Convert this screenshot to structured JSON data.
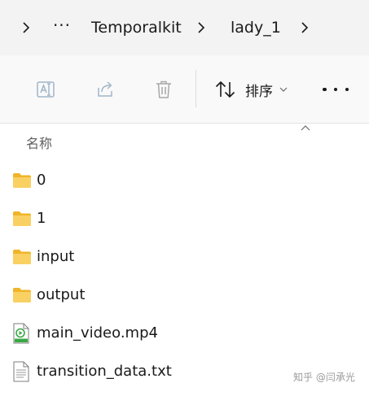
{
  "breadcrumb": {
    "more_label": "···",
    "items": [
      {
        "label": "Temporalkit"
      },
      {
        "label": "lady_1"
      }
    ]
  },
  "toolbar": {
    "buttons": [
      {
        "name": "rename",
        "icon": "rename-icon"
      },
      {
        "name": "share",
        "icon": "share-icon"
      },
      {
        "name": "delete",
        "icon": "trash-icon"
      }
    ],
    "sort_label": "排序",
    "more_icon": "more-icon"
  },
  "list": {
    "column_header": "名称",
    "items": [
      {
        "name": "0",
        "type": "folder"
      },
      {
        "name": "1",
        "type": "folder"
      },
      {
        "name": "input",
        "type": "folder"
      },
      {
        "name": "output",
        "type": "folder"
      },
      {
        "name": "main_video.mp4",
        "type": "video"
      },
      {
        "name": "transition_data.txt",
        "type": "text"
      }
    ]
  },
  "watermark": "知乎 @闫承光",
  "colors": {
    "breadcrumb_bg": "#f3f3f3",
    "toolbar_bg": "#f9f9f9",
    "folder": "#f7c748",
    "video_badge": "#39a845",
    "disabled_icon": "#9fb6c9"
  }
}
